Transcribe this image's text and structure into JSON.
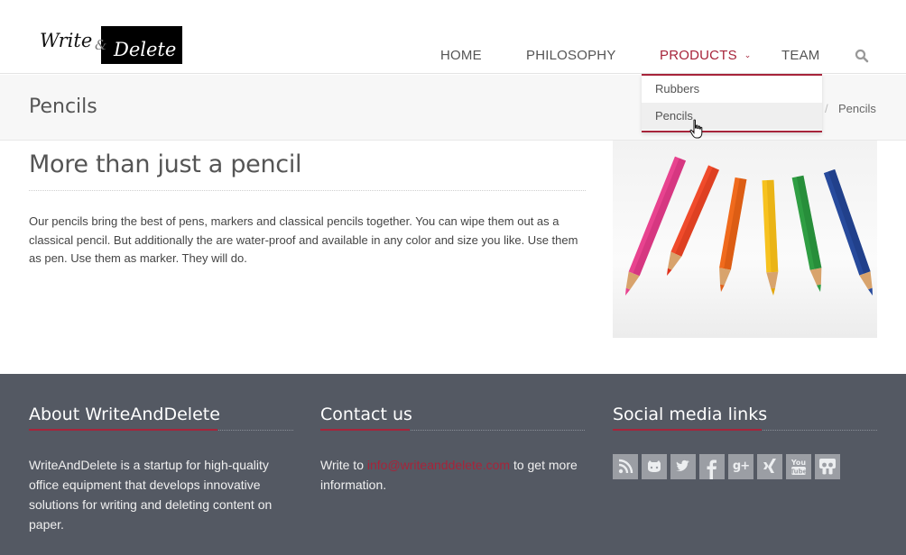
{
  "logo": {
    "word1": "Write",
    "amp": "&",
    "word2": "Delete"
  },
  "nav": {
    "items": [
      {
        "label": "HOME"
      },
      {
        "label": "PHILOSOPHY"
      },
      {
        "label": "PRODUCTS",
        "active": true
      },
      {
        "label": "TEAM"
      }
    ],
    "dropdown_chevron": "⌄",
    "search_icon": "search-icon"
  },
  "dropdown": {
    "items": [
      {
        "label": "Rubbers"
      },
      {
        "label": "Pencils",
        "hovered": true
      }
    ]
  },
  "page": {
    "title": "Pencils",
    "breadcrumb_separator": "/",
    "breadcrumb_current": "Pencils"
  },
  "main": {
    "heading": "More than just a pencil",
    "body": "Our pencils bring the best of pens, markers and classical pencils together. You can wipe them out as a classical pencil. But additionally the are water-proof and available in any color and size you like. Use them as pen. Use them as marker. They will do.",
    "image_icon": "colored-pencils-image"
  },
  "footer": {
    "about": {
      "title": "About WriteAndDelete",
      "text": "WriteAndDelete is a startup for high-quality office equipment that develops innovative solutions for writing and deleting content on paper."
    },
    "contact": {
      "title": "Contact us",
      "prefix": "Write to ",
      "email": "info@writeanddelete.com",
      "suffix": " to get more information."
    },
    "social": {
      "title": "Social media links",
      "icons": [
        "rss-icon",
        "github-icon",
        "twitter-icon",
        "facebook-icon",
        "google-plus-icon",
        "xing-icon",
        "youtube-icon",
        "slideshare-icon"
      ]
    }
  },
  "colors": {
    "accent": "#a7243a",
    "footer_bg": "#545963",
    "titlebar_bg": "#f7f7f7",
    "social_icon_bg": "#9b9ea4"
  }
}
